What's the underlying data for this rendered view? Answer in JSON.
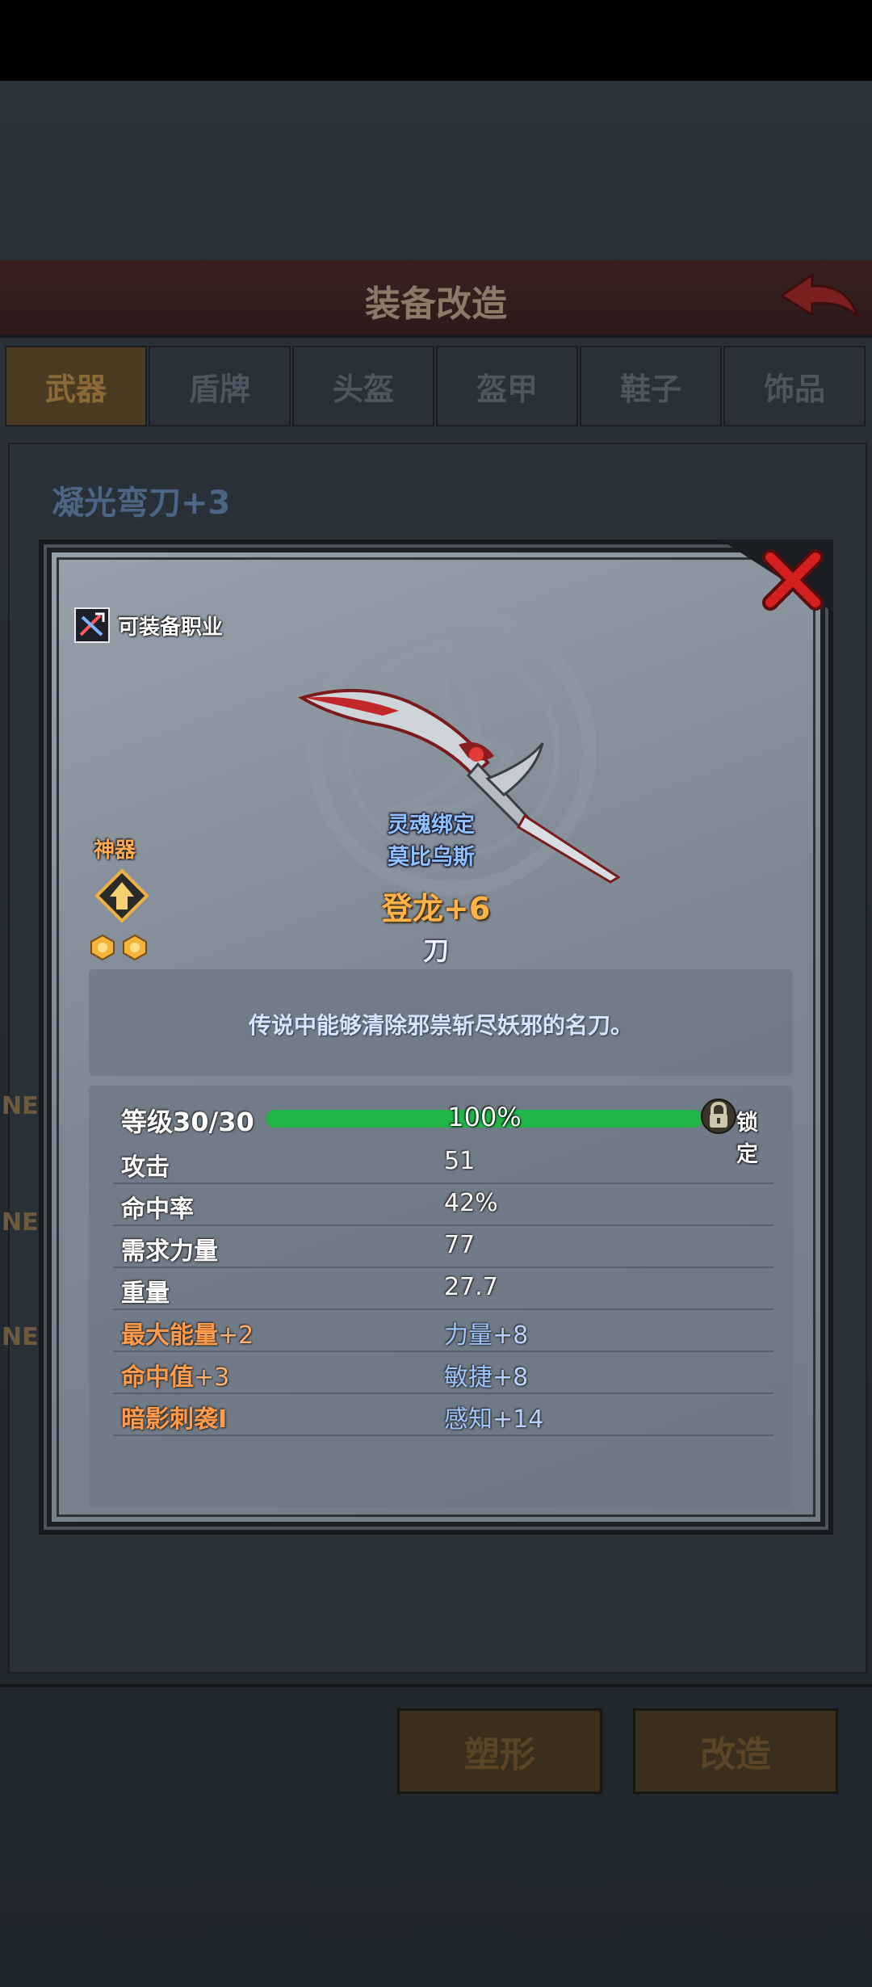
{
  "screen": {
    "title": "装备改造",
    "tabs": [
      "武器",
      "盾牌",
      "头盔",
      "盔甲",
      "鞋子",
      "饰品"
    ],
    "current_item": "凝光弯刀+3",
    "ne_tags": [
      "NE",
      "NE",
      "NE"
    ],
    "buttons": {
      "reshape": "塑形",
      "modify": "改造"
    }
  },
  "dialog": {
    "class_label": "可装备职业",
    "artifact_label": "神器",
    "soul_bound": "灵魂绑定",
    "owner": "莫比乌斯",
    "item_name": "登龙",
    "item_plus": "+6",
    "item_type": "刀",
    "description": "传说中能够清除邪祟斩尽妖邪的名刀。",
    "level": {
      "label": "等级30/30",
      "progress_percent": 100,
      "progress_text": "100%",
      "lock_label": "锁定"
    },
    "stats": [
      {
        "label": "攻击",
        "value": "51"
      },
      {
        "label": "命中率",
        "value": "42%"
      },
      {
        "label": "需求力量",
        "value": "77"
      },
      {
        "label": "重量",
        "value": "27.7"
      }
    ],
    "bonuses": [
      {
        "left_name": "最大能量",
        "left_plus": "+2",
        "right_name": "力量",
        "right_plus": "+8"
      },
      {
        "left_name": "命中值",
        "left_plus": "+3",
        "right_name": "敏捷",
        "right_plus": "+8"
      },
      {
        "left_name": "暗影刺袭I",
        "left_plus": "",
        "right_name": "感知",
        "right_plus": "+14"
      }
    ],
    "icons": [
      "class-icon",
      "artifact-icon",
      "star-icon",
      "close-icon",
      "lock-icon",
      "back-arrow-icon"
    ],
    "colors": {
      "progress": "#21b54a",
      "item_name": "#ffb347",
      "skill": "#ff9b4a",
      "stat_blue": "#9ec5ff"
    }
  }
}
